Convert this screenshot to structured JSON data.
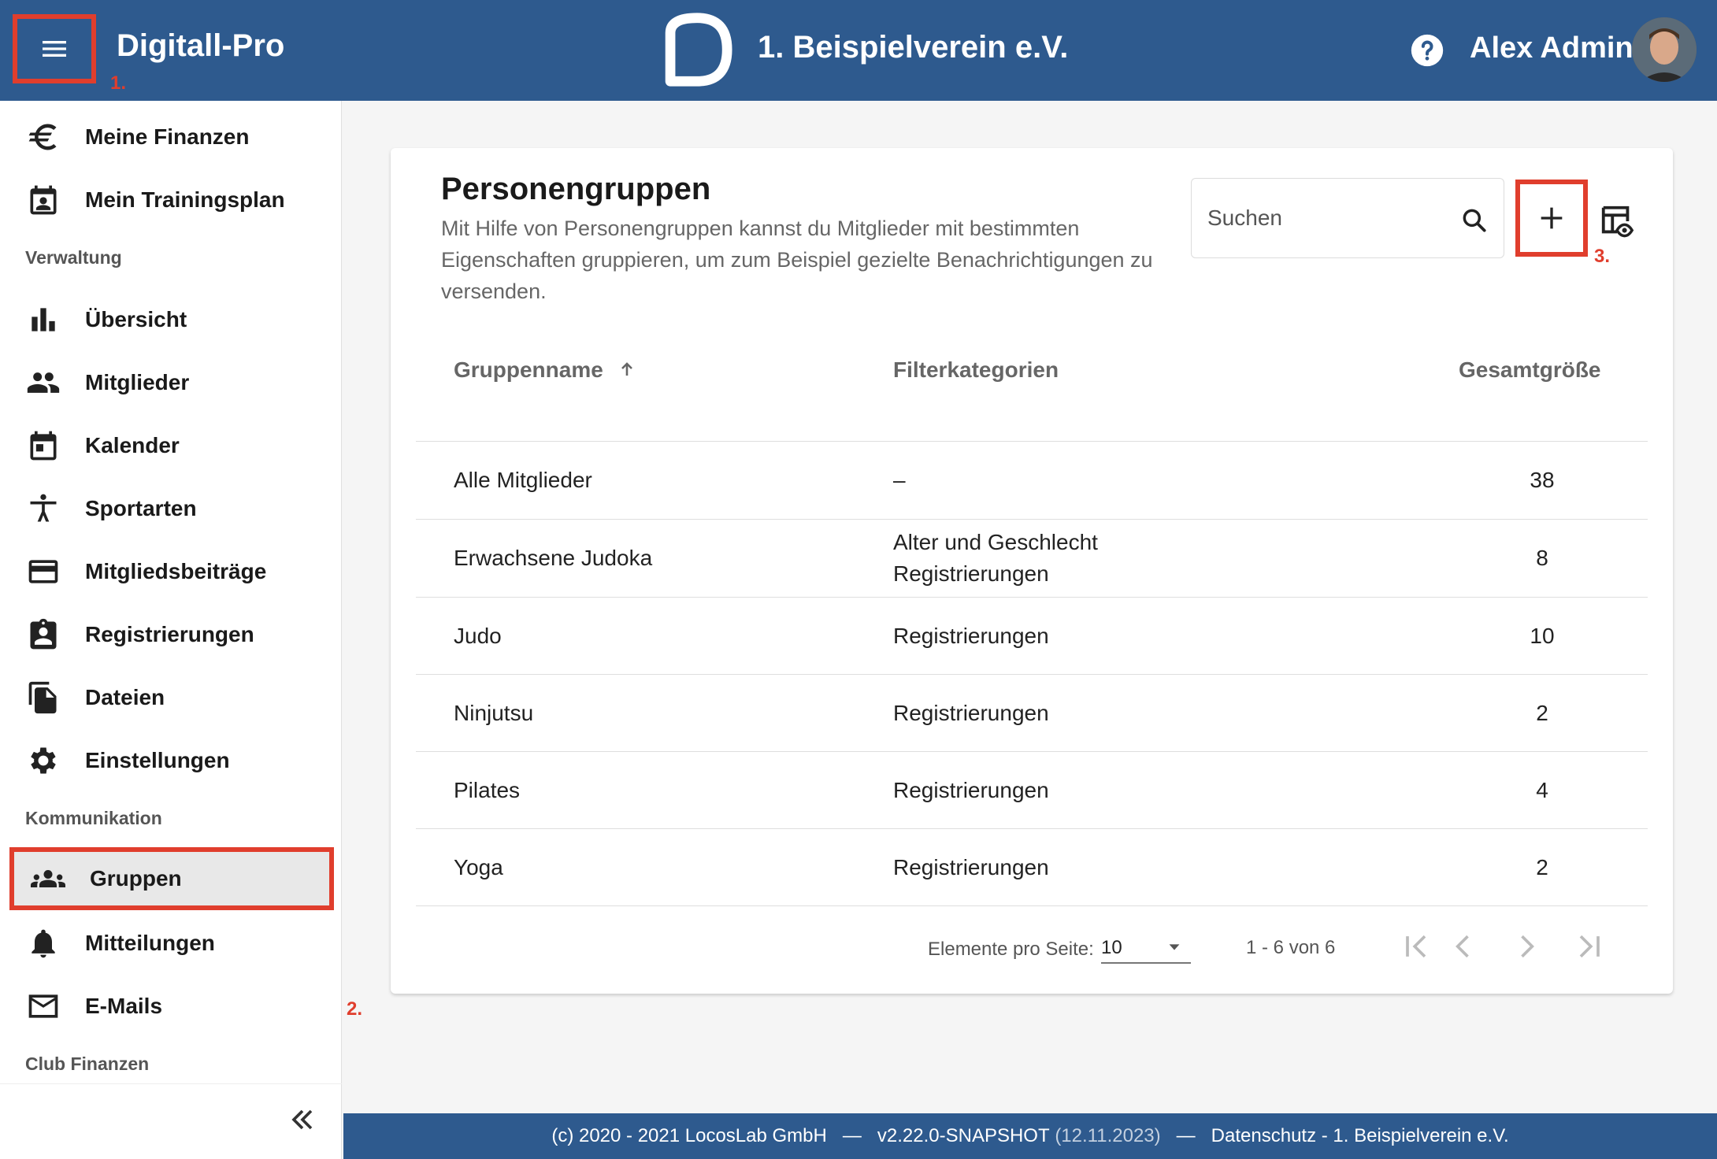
{
  "header": {
    "app_title": "Digitall-Pro",
    "club_name": "1. Beispielverein e.V.",
    "user_name": "Alex Admin",
    "annotation_1": "1."
  },
  "sidebar": {
    "items_top": [
      {
        "label": "Meine Finanzen",
        "icon": "euro-icon"
      },
      {
        "label": "Mein Trainingsplan",
        "icon": "training-plan-icon"
      }
    ],
    "section_verwaltung": "Verwaltung",
    "items_verwaltung": [
      {
        "label": "Übersicht",
        "icon": "bar-chart-icon"
      },
      {
        "label": "Mitglieder",
        "icon": "people-icon"
      },
      {
        "label": "Kalender",
        "icon": "calendar-icon"
      },
      {
        "label": "Sportarten",
        "icon": "sport-icon"
      },
      {
        "label": "Mitgliedsbeiträge",
        "icon": "credit-card-icon"
      },
      {
        "label": "Registrierungen",
        "icon": "clipboard-account-icon"
      },
      {
        "label": "Dateien",
        "icon": "files-icon"
      },
      {
        "label": "Einstellungen",
        "icon": "gear-icon"
      }
    ],
    "section_kommunikation": "Kommunikation",
    "items_kommunikation": [
      {
        "label": "Gruppen",
        "icon": "groups-icon",
        "active": true
      },
      {
        "label": "Mitteilungen",
        "icon": "bell-icon"
      },
      {
        "label": "E-Mails",
        "icon": "mail-icon"
      }
    ],
    "section_club_finanzen": "Club Finanzen",
    "annotation_2": "2."
  },
  "card": {
    "title": "Personengruppen",
    "description": "Mit Hilfe von Personengruppen kannst du Mitglieder mit bestimmten Eigenschaften gruppieren, um zum Beispiel gezielte Benachrichtigungen zu versenden.",
    "search_placeholder": "Suchen",
    "annotation_3": "3."
  },
  "table": {
    "columns": [
      "Gruppenname",
      "Filterkategorien",
      "Gesamtgröße"
    ],
    "rows": [
      {
        "name": "Alle Mitglieder",
        "filters": [
          "–"
        ],
        "size": "38"
      },
      {
        "name": "Erwachsene Judoka",
        "filters": [
          "Alter und Geschlecht",
          "Registrierungen"
        ],
        "size": "8"
      },
      {
        "name": "Judo",
        "filters": [
          "Registrierungen"
        ],
        "size": "10"
      },
      {
        "name": "Ninjutsu",
        "filters": [
          "Registrierungen"
        ],
        "size": "2"
      },
      {
        "name": "Pilates",
        "filters": [
          "Registrierungen"
        ],
        "size": "4"
      },
      {
        "name": "Yoga",
        "filters": [
          "Registrierungen"
        ],
        "size": "2"
      }
    ]
  },
  "pagination": {
    "items_per_page_label": "Elemente pro Seite:",
    "items_per_page": "10",
    "range": "1 - 6 von 6"
  },
  "footer": {
    "copyright": "(c) 2020 - 2021 LocosLab GmbH",
    "separator": "—",
    "version": "v2.22.0-SNAPSHOT",
    "build_date": "(12.11.2023)",
    "privacy": "Datenschutz - 1. Beispielverein e.V."
  },
  "colors": {
    "header_bg": "#2e5a8e",
    "annotation_red": "#e03e2d",
    "active_bg": "#e8e8e8"
  }
}
